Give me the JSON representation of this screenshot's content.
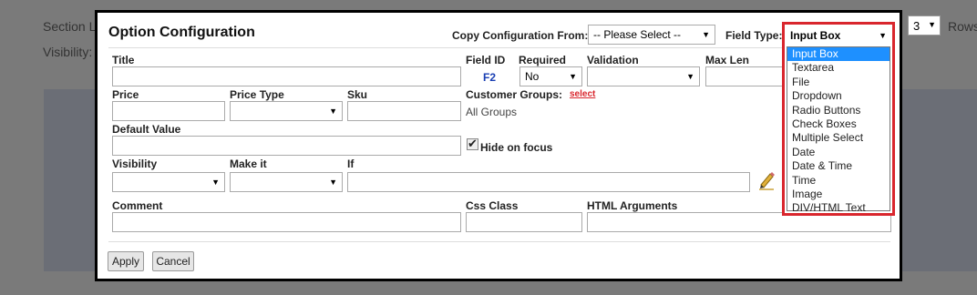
{
  "background": {
    "section_label": "Section L",
    "visibility_label": "Visibility:",
    "rows_value": "3",
    "rows_label": "Rows"
  },
  "modal": {
    "title": "Option Configuration",
    "copy_from_label": "Copy Configuration From:",
    "copy_from_value": "-- Please Select --",
    "field_type_label": "Field Type:",
    "field_type_value": "Input Box",
    "field_type_options": [
      "Input Box",
      "Textarea",
      "File",
      "Dropdown",
      "Radio Buttons",
      "Check Boxes",
      "Multiple Select",
      "Date",
      "Date & Time",
      "Time",
      "Image",
      "DIV/HTML Text"
    ],
    "labels": {
      "title": "Title",
      "field_id": "Field ID",
      "required": "Required",
      "validation": "Validation",
      "max_len": "Max Len",
      "price": "Price",
      "price_type": "Price Type",
      "sku": "Sku",
      "customer_groups": "Customer Groups:",
      "select_link": "select",
      "all_groups": "All Groups",
      "default_value": "Default Value",
      "hide_on_focus": "Hide on focus",
      "visibility": "Visibility",
      "make_it": "Make it",
      "if": "If",
      "comment": "Comment",
      "css_class": "Css Class",
      "html_arguments": "HTML Arguments"
    },
    "field_id_value": "F2",
    "required_value": "No",
    "hide_on_focus_checked": true,
    "buttons": {
      "apply": "Apply",
      "cancel": "Cancel"
    }
  }
}
